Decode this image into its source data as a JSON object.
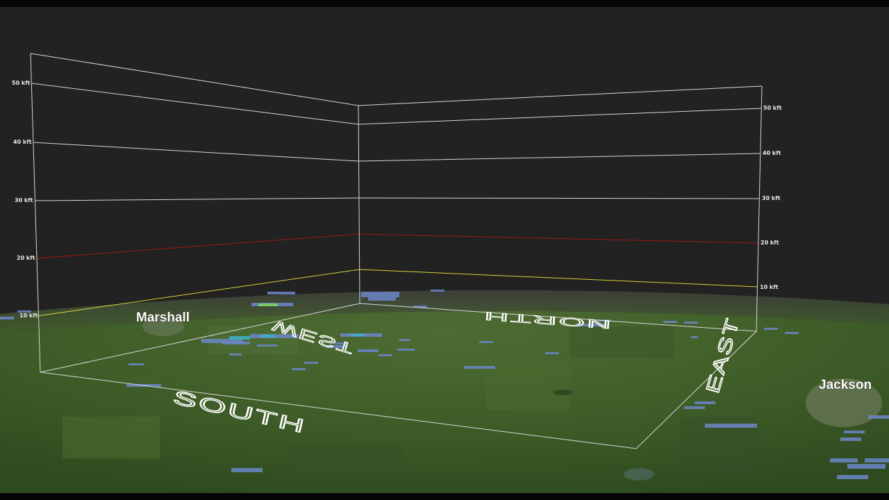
{
  "view": {
    "type": "3d-radar-volume",
    "background_sky": "#222222",
    "terrain_color": "#3f5e28"
  },
  "altitude_axis": {
    "labels": [
      "10 kft",
      "20 kft",
      "30 kft",
      "40 kft",
      "50 kft"
    ],
    "highlight_colors": {
      "10 kft": "#d8d23a",
      "20 kft": "#a01818"
    },
    "default_line_color": "#d8d8d8"
  },
  "directions": {
    "south": "SOUTH",
    "west": "WEST",
    "north": "NORTH",
    "east": "EAST"
  },
  "places": {
    "west_city": "Marshall",
    "east_city": "Jackson"
  },
  "radar_returns": {
    "palette": {
      "light": "#6b86c8",
      "moderate": "#3db4c8",
      "heavy": "#7ed65a"
    }
  }
}
